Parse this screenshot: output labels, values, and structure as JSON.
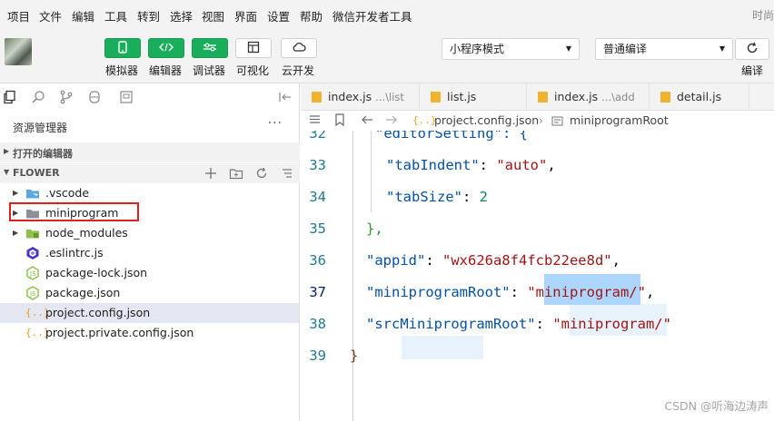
{
  "menu": {
    "items": [
      "项目",
      "文件",
      "编辑",
      "工具",
      "转到",
      "选择",
      "视图",
      "界面",
      "设置",
      "帮助",
      "微信开发者工具"
    ],
    "right_text": "时尚"
  },
  "toolbar": {
    "buttons": [
      {
        "label": "模拟器",
        "icon": "phone-icon"
      },
      {
        "label": "编辑器",
        "icon": "code-icon"
      },
      {
        "label": "调试器",
        "icon": "debug-icon"
      },
      {
        "label": "可视化",
        "icon": "layout-icon"
      },
      {
        "label": "云开发",
        "icon": "cloud-icon"
      }
    ],
    "mode_select": "小程序模式",
    "compile_select": "普通编译",
    "compile_label": "编译"
  },
  "sidebar": {
    "title": "资源管理器",
    "more": "···",
    "open_editors": "打开的编辑器",
    "project": "FLOWER",
    "tree": [
      {
        "name": ".vscode",
        "type": "folder-vscode"
      },
      {
        "name": "miniprogram",
        "type": "folder"
      },
      {
        "name": "node_modules",
        "type": "folder-node"
      },
      {
        "name": ".eslintrc.js",
        "type": "eslint"
      },
      {
        "name": "package-lock.json",
        "type": "node-json"
      },
      {
        "name": "package.json",
        "type": "node-json"
      },
      {
        "name": "project.config.json",
        "type": "json"
      },
      {
        "name": "project.private.config.json",
        "type": "json"
      }
    ]
  },
  "tabs": [
    {
      "name": "index.js",
      "path": "...\\list"
    },
    {
      "name": "list.js",
      "path": ""
    },
    {
      "name": "index.js",
      "path": "...\\add"
    },
    {
      "name": "detail.js",
      "path": ""
    }
  ],
  "breadcrumb": {
    "file": "project.config.json",
    "symbol": "miniprogramRoot"
  },
  "code": {
    "lines": [
      32,
      33,
      34,
      35,
      36,
      37,
      38,
      39
    ],
    "l32": "\"editorSetting\": {",
    "l33_key": "\"tabIndent\"",
    "l33_val": "\"auto\"",
    "l34_key": "\"tabSize\"",
    "l34_val": "2",
    "l35": "},",
    "l36_key": "\"appid\"",
    "l36_val": "\"wx626a8f4fcb22ee8d\"",
    "l37_key": "\"miniprogramRoot\"",
    "l37_val": "\"miniprogram/\"",
    "l38_key": "\"srcMiniprogramRoot\"",
    "l38_val": "\"miniprogram/\"",
    "l39": "}"
  },
  "watermark": "CSDN @听海边涛声",
  "colors": {
    "accent_green": "#1aad5c",
    "selection_red": "#e02020",
    "string": "#a31515",
    "key": "#0451a5",
    "number": "#098658"
  }
}
